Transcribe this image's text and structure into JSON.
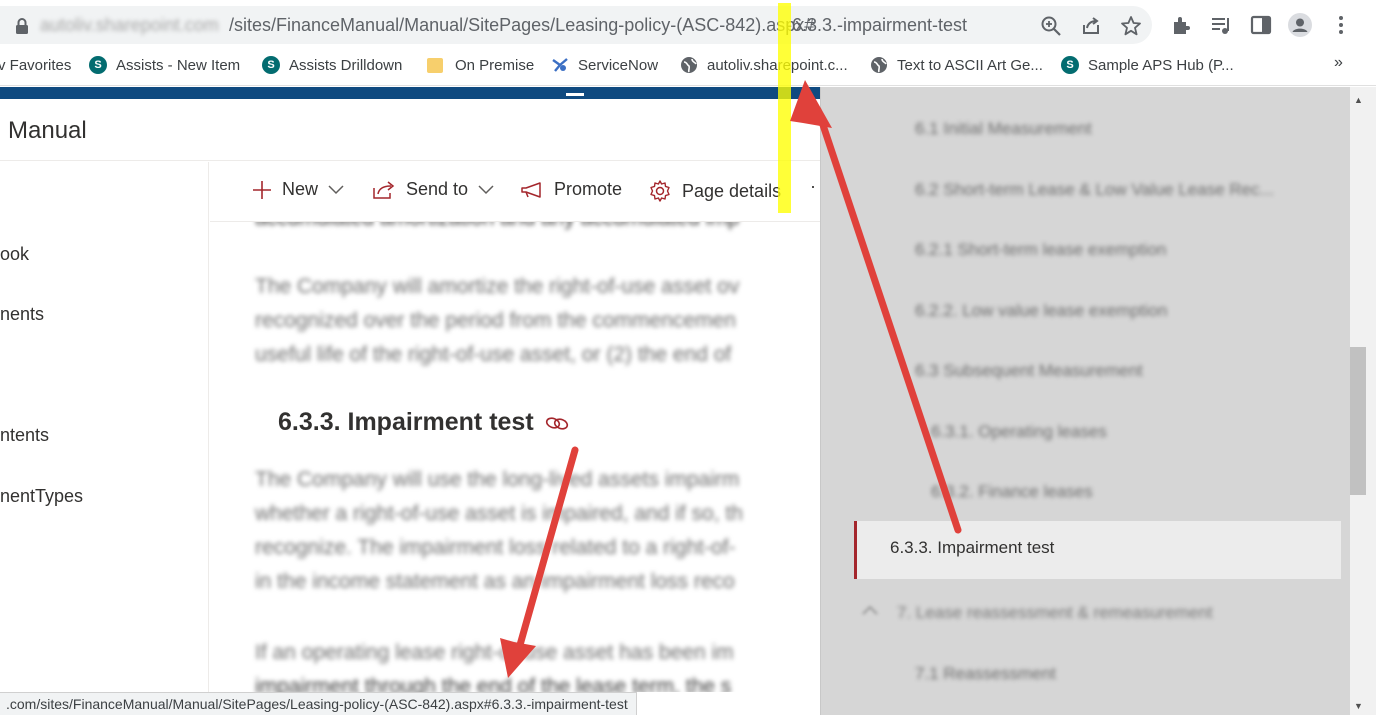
{
  "browser": {
    "url_host": "autoliv.sharepoint.com",
    "url_path": "/sites/FinanceManual/Manual/SitePages/Leasing-policy-(ASC-842).aspx#",
    "url_fragment": "-6.3.3.-impairment-test",
    "bookmarks": [
      {
        "label": "v Favorites",
        "icon": "none"
      },
      {
        "label": "Assists - New Item",
        "icon": "sharepoint-icon"
      },
      {
        "label": "Assists Drilldown",
        "icon": "sharepoint-icon"
      },
      {
        "label": "On Premise",
        "icon": "folder-icon"
      },
      {
        "label": "ServiceNow",
        "icon": "servicenow-icon"
      },
      {
        "label": "autoliv.sharepoint.c...",
        "icon": "globe-icon"
      },
      {
        "label": "Text to ASCII Art Ge...",
        "icon": "globe-icon"
      },
      {
        "label": "Sample APS Hub (P...",
        "icon": "sharepoint-icon"
      }
    ],
    "bookmarks_more": "»"
  },
  "site": {
    "title": "Manual"
  },
  "left_nav": {
    "items": [
      "ook",
      "nents",
      "ntents",
      "nentTypes"
    ]
  },
  "command_bar": {
    "new_label": "New",
    "send_to_label": "Send to",
    "promote_label": "Promote",
    "page_details_label": "Page details",
    "overflow_label": "·"
  },
  "content": {
    "line_top": "accumulated amortization and any accumulated imp",
    "para1": [
      "The Company will amortize the right-of-use asset ov",
      "recognized over the period from the commencemen",
      "useful life of the right-of-use asset, or (2) the end of"
    ],
    "heading": "6.3.3. Impairment test",
    "para2": [
      "The Company will use the long-lived assets impairm",
      "whether a right-of-use asset is impaired, and if so, th",
      "recognize. The impairment loss related to a right-of-",
      "in the income statement as an impairment loss reco"
    ],
    "para3": [
      "If an operating lease right-of-use asset has been im",
      "impairment through the end of the lease term, the s"
    ]
  },
  "toc": {
    "items": [
      "6.1 Initial Measurement",
      "6.2 Short-term Lease & Low Value Lease Rec...",
      "6.2.1 Short-term lease exemption",
      "6.2.2. Low value lease exemption",
      "6.3 Subsequent Measurement",
      "6.3.1. Operating leases",
      "6.3.2. Finance leases"
    ],
    "active_item": "6.3.3. Impairment test",
    "after_items": [
      "7.  Lease reassessment & remeasurement",
      "7.1 Reassessment"
    ]
  },
  "status_url": ".com/sites/FinanceManual/Manual/SitePages/Leasing-policy-(ASC-842).aspx#6.3.3.-impairment-test",
  "colors": {
    "suitebar": "#0f4a80",
    "accent": "#a4262c",
    "arrow": "#e0413b",
    "highlight": "#ffff00"
  }
}
